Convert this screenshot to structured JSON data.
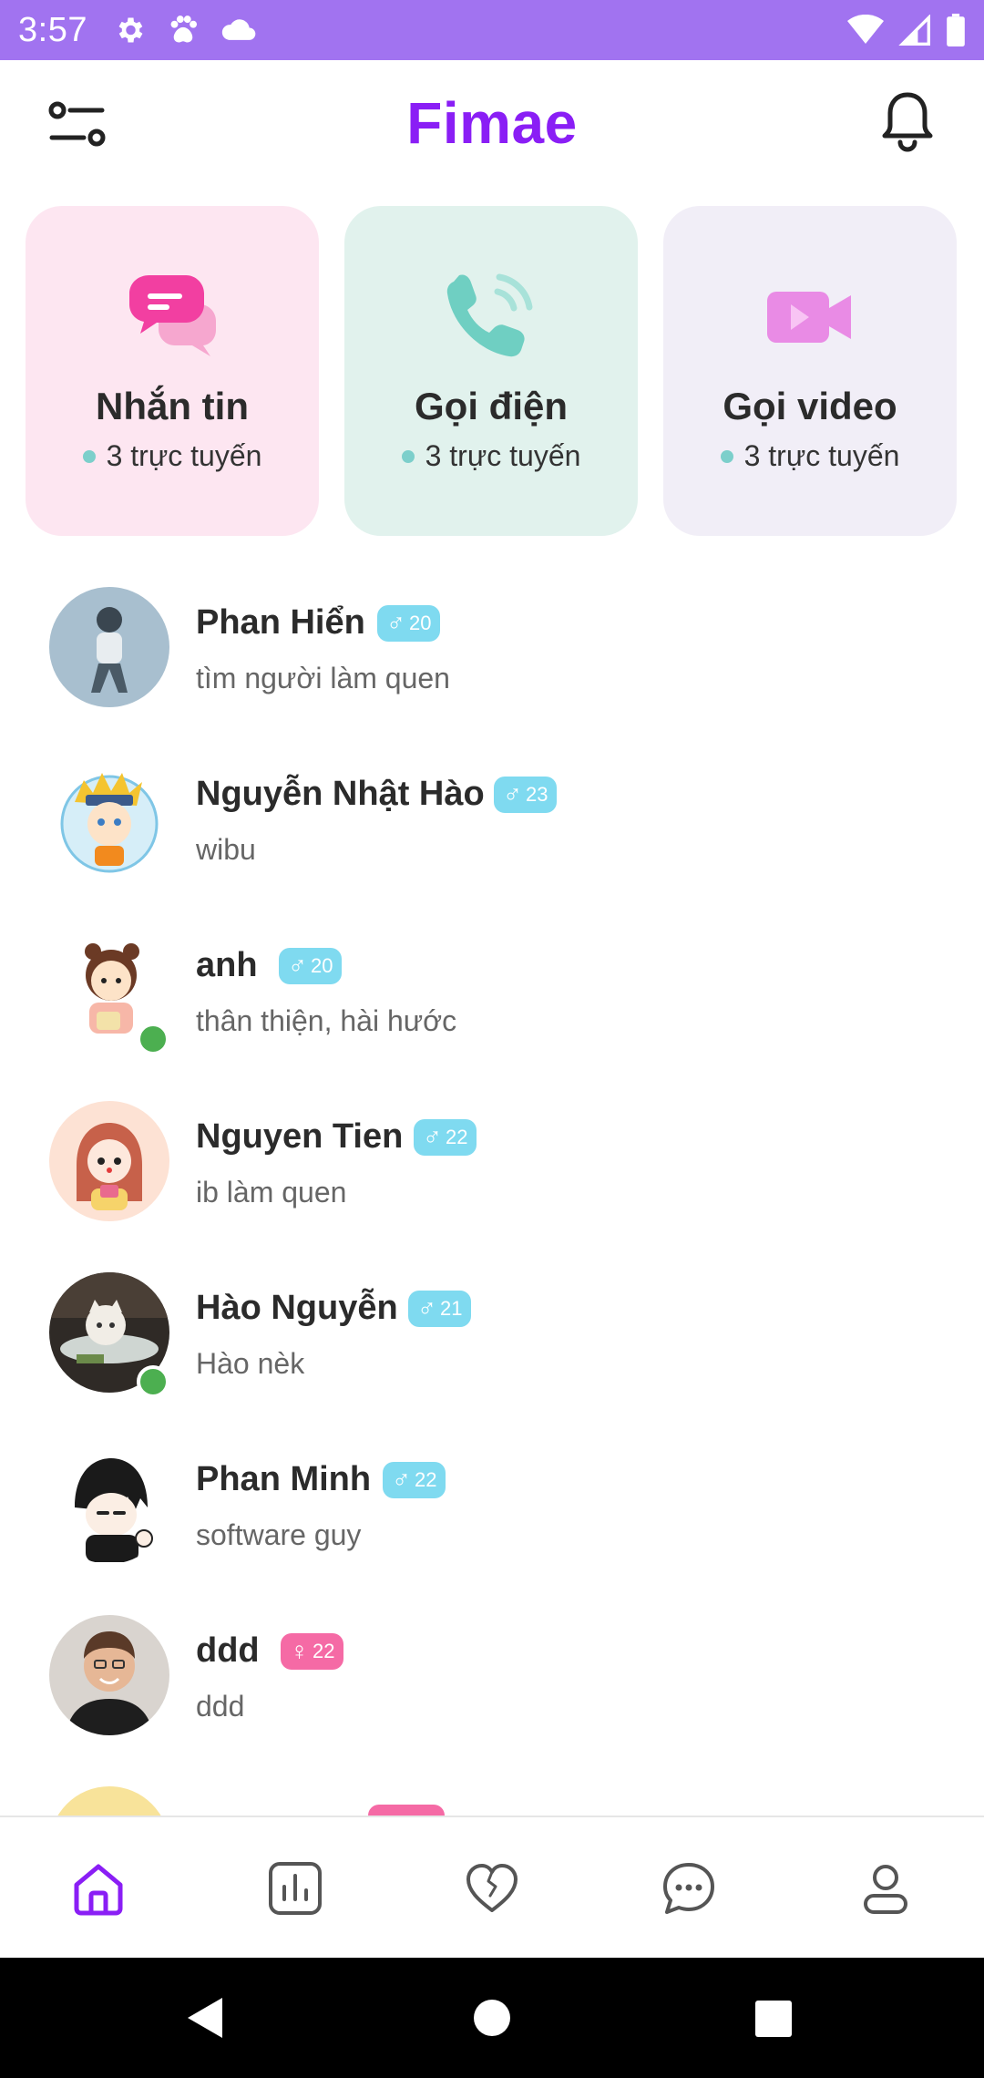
{
  "status_bar": {
    "time": "3:57",
    "icons_left": [
      "gear-icon",
      "paw-icon",
      "cloud-icon"
    ],
    "icons_right": [
      "wifi-icon",
      "signal-icon",
      "battery-icon"
    ],
    "color": "#a173f0"
  },
  "header": {
    "title": "Fimae",
    "title_color": "#8a1ef5",
    "filter_icon": "filter-icon",
    "bell_icon": "bell-icon"
  },
  "cards": [
    {
      "title": "Nhắn tin",
      "online": "3 trực tuyến",
      "icon": "chat-bubbles-icon",
      "bg": "#fde6f1"
    },
    {
      "title": "Gọi điện",
      "online": "3 trực tuyến",
      "icon": "phone-icon",
      "bg": "#e1f2ed"
    },
    {
      "title": "Gọi video",
      "online": "3 trực tuyến",
      "icon": "video-camera-icon",
      "bg": "#f1eef7"
    }
  ],
  "users": [
    {
      "name": "Phan Hiển",
      "gender": "♂",
      "age": "20",
      "status": "tìm người làm quen",
      "online": false
    },
    {
      "name": "Nguyễn Nhật Hào",
      "gender": "♂",
      "age": "23",
      "status": "wibu",
      "online": false
    },
    {
      "name": "anh",
      "gender": "♂",
      "age": "20",
      "status": "thân thiện, hài hước",
      "online": true
    },
    {
      "name": "Nguyen Tien",
      "gender": "♂",
      "age": "22",
      "status": "ib làm quen",
      "online": false
    },
    {
      "name": "Hào Nguyễn",
      "gender": "♂",
      "age": "21",
      "status": "Hào nèk",
      "online": true
    },
    {
      "name": "Phan Minh",
      "gender": "♂",
      "age": "22",
      "status": "software guy",
      "online": false
    },
    {
      "name": "ddd",
      "gender": "♀",
      "age": "22",
      "status": "ddd",
      "online": false
    },
    {
      "name": "",
      "gender": "♀",
      "age": "",
      "status": "",
      "online": false
    }
  ],
  "bottom_nav": {
    "items": [
      "home-icon",
      "stats-icon",
      "heart-icon",
      "chat-icon",
      "profile-icon"
    ],
    "active": "home-icon",
    "active_color": "#8a1ef5"
  },
  "system_nav": [
    "back-icon",
    "home-circle-icon",
    "recents-icon"
  ]
}
